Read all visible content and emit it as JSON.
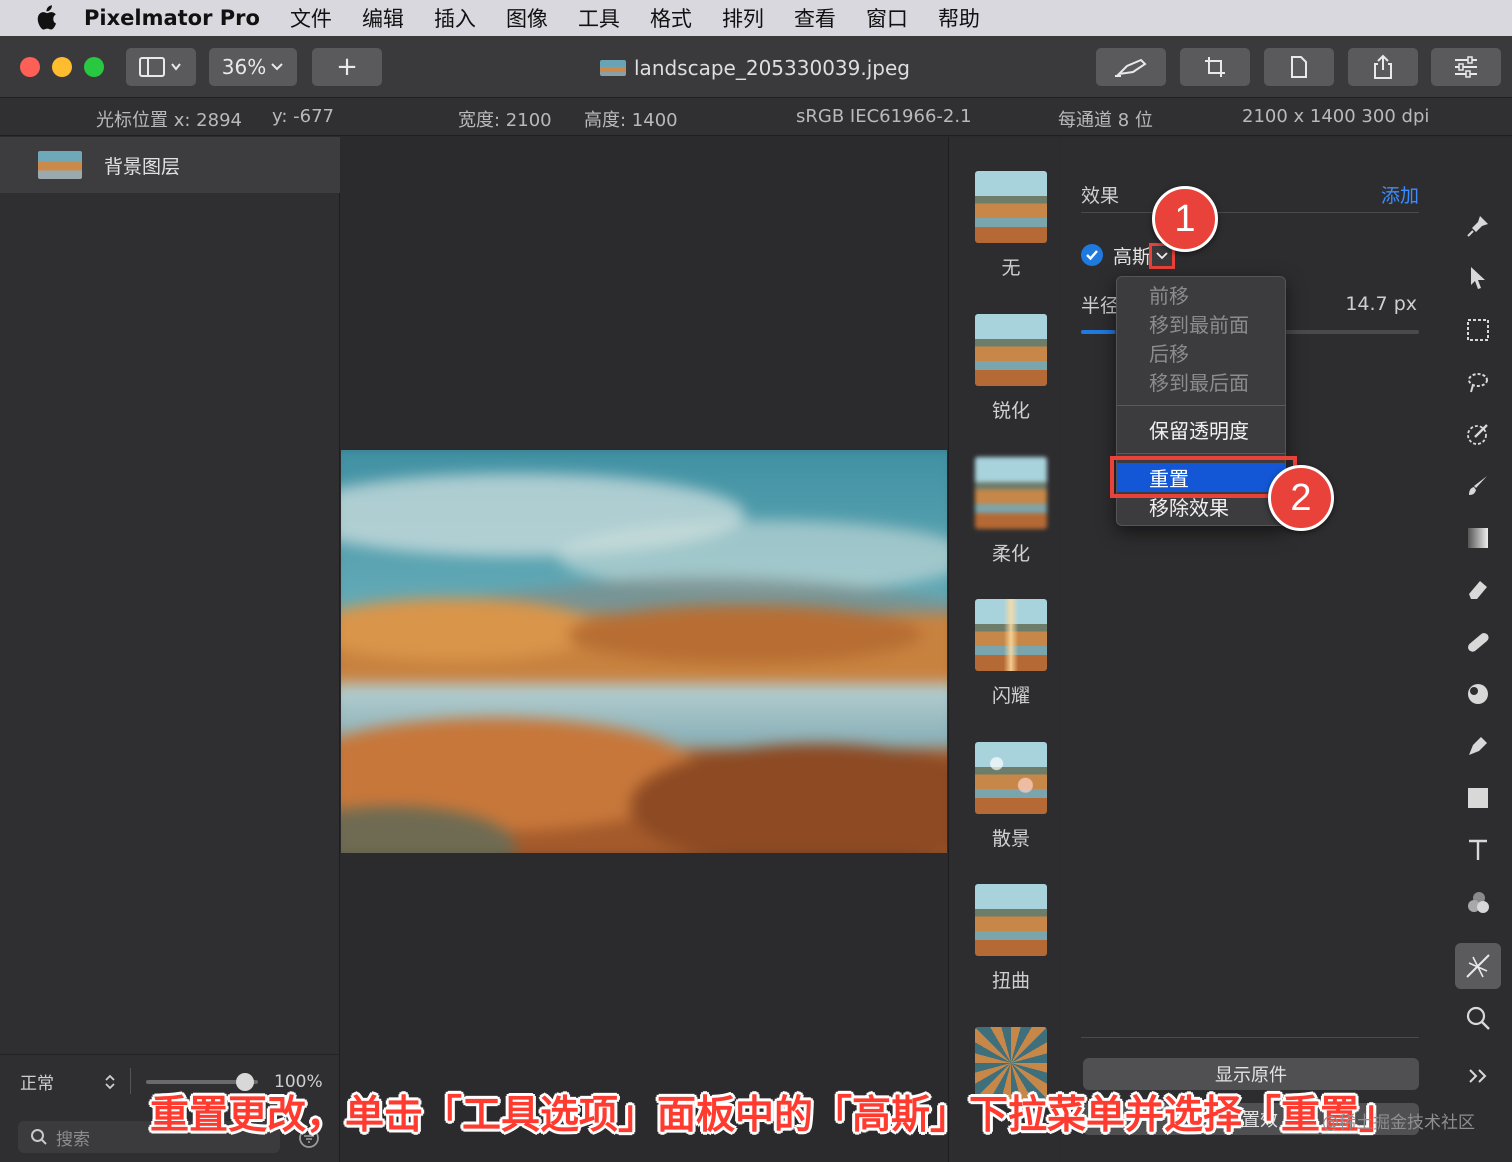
{
  "menubar": {
    "app": "Pixelmator Pro",
    "items": [
      "文件",
      "编辑",
      "插入",
      "图像",
      "工具",
      "格式",
      "排列",
      "查看",
      "窗口",
      "帮助"
    ]
  },
  "toolbar": {
    "zoom": "36%",
    "add_label": "+",
    "document_title": "landscape_205330039.jpeg"
  },
  "infobar": {
    "cursor_x": "光标位置 x:  2894",
    "cursor_y": "y:  -677",
    "width": "宽度:  2100",
    "height": "高度:  1400",
    "colorspace": "sRGB IEC61966-2.1",
    "depth": "每通道 8 位",
    "resolution": "2100 x 1400 300 dpi"
  },
  "layers": {
    "items": [
      {
        "name": "背景图层"
      }
    ],
    "blend_mode": "正常",
    "opacity": "100%",
    "search_placeholder": "搜索"
  },
  "effects_list": [
    {
      "label": "无"
    },
    {
      "label": "锐化"
    },
    {
      "label": "柔化"
    },
    {
      "label": "闪耀"
    },
    {
      "label": "散景"
    },
    {
      "label": "扭曲"
    }
  ],
  "options": {
    "header": "效果",
    "add": "添加",
    "effect_name": "高斯",
    "radius_label": "半径",
    "radius_value": "14.7 px",
    "radius_fraction": 0.1,
    "show_original": "显示原件",
    "reset_button": "重置效"
  },
  "dropdown": {
    "disabled_items": [
      "前移",
      "移到最前面",
      "后移",
      "移到最后面"
    ],
    "preserve": "保留透明度",
    "reset": "重置",
    "remove": "移除效果"
  },
  "annotations": {
    "step1": "1",
    "step2": "2",
    "caption": "重置更改，单击「工具选项」面板中的「高斯」下拉菜单并选择「重置」",
    "watermark": "@稀土掘金技术社区"
  },
  "colors": {
    "accent": "#1f7ae0",
    "highlight": "#1357d6",
    "annotation": "#e8423a",
    "link": "#3b8cff"
  }
}
